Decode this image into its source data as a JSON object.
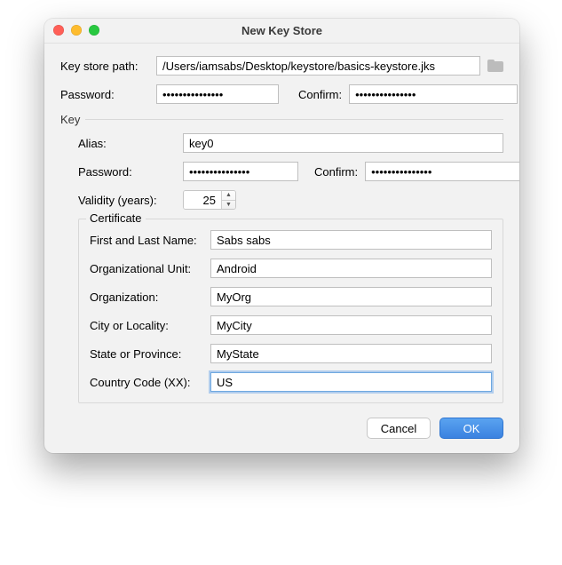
{
  "title": "New Key Store",
  "labels": {
    "keystore_path": "Key store path:",
    "password": "Password:",
    "confirm": "Confirm:",
    "key_section": "Key",
    "alias": "Alias:",
    "key_password": "Password:",
    "key_confirm": "Confirm:",
    "validity": "Validity (years):",
    "certificate_section": "Certificate",
    "first_last": "First and Last Name:",
    "org_unit": "Organizational Unit:",
    "organization": "Organization:",
    "city": "City or Locality:",
    "state": "State or Province:",
    "country": "Country Code (XX):"
  },
  "values": {
    "keystore_path": "/Users/iamsabs/Desktop/keystore/basics-keystore.jks",
    "password": "•••••••••••••••",
    "confirm": "•••••••••••••••",
    "alias": "key0",
    "key_password": "•••••••••••••••",
    "key_confirm": "•••••••••••••••",
    "validity": "25",
    "first_last": "Sabs sabs",
    "org_unit": "Android",
    "organization": "MyOrg",
    "city": "MyCity",
    "state": "MyState",
    "country": "US"
  },
  "buttons": {
    "cancel": "Cancel",
    "ok": "OK"
  }
}
